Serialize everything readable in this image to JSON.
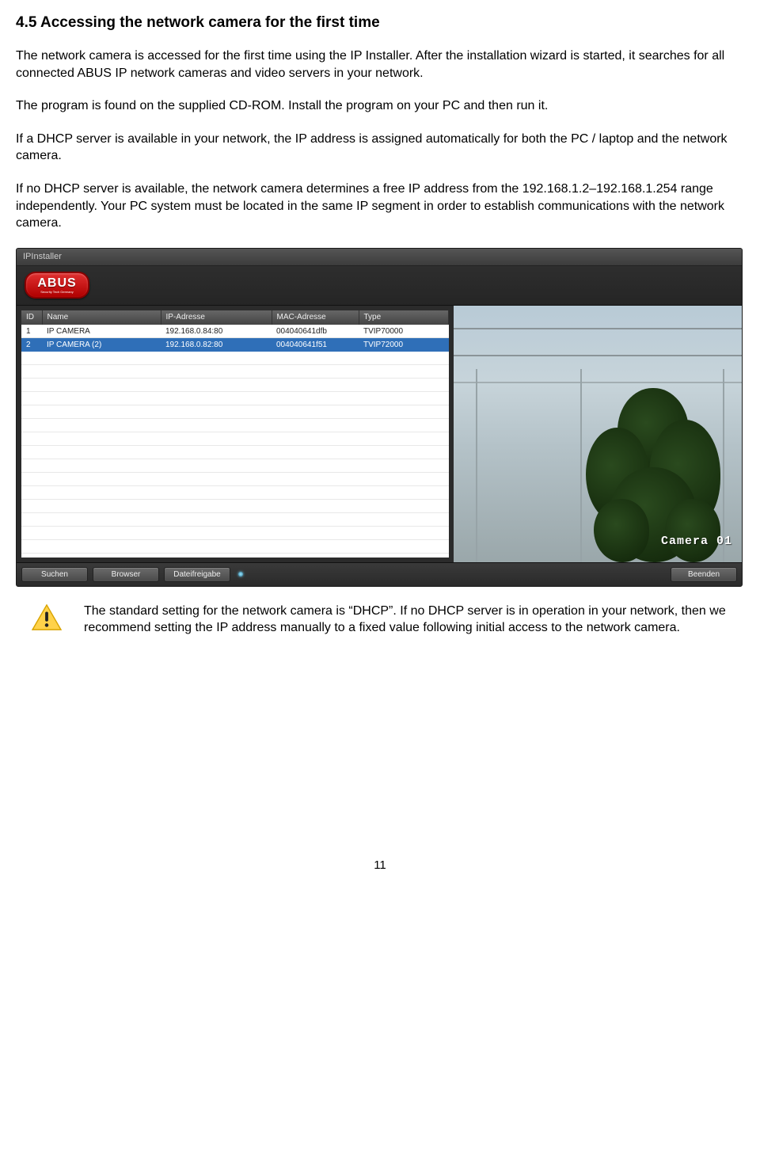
{
  "heading": "4.5 Accessing the network camera for the first time",
  "paragraphs": {
    "p1": "The network camera is accessed for the first time using the IP Installer. After the installation wizard is started, it searches for all connected ABUS IP network cameras and video servers in your network.",
    "p2": "The program is found on the supplied CD-ROM. Install the program on your PC and then run it.",
    "p3": "If a DHCP server is available in your network, the IP address is assigned automatically for both the PC / laptop and the network camera.",
    "p4": "If no DHCP server is available, the network camera determines a free IP address from the 192.168.1.2–192.168.1.254 range independently. Your PC system must be located in the same IP segment in order to establish communications with the network camera."
  },
  "ipinstaller": {
    "window_title": "IPInstaller",
    "logo_main": "ABUS",
    "logo_sub": "Security Tech Germany",
    "columns": {
      "id": "ID",
      "name": "Name",
      "ip": "IP-Adresse",
      "mac": "MAC-Adresse",
      "type": "Type"
    },
    "rows": [
      {
        "id": "1",
        "name": "IP CAMERA",
        "ip": "192.168.0.84:80",
        "mac": "004040641dfb",
        "type": "TVIP70000"
      },
      {
        "id": "2",
        "name": "IP CAMERA (2)",
        "ip": "192.168.0.82:80",
        "mac": "004040641f51",
        "type": "TVIP72000"
      }
    ],
    "preview_overlay": "Camera 01",
    "buttons": {
      "search": "Suchen",
      "browser": "Browser",
      "fileshare": "Dateifreigabe",
      "exit": "Beenden"
    }
  },
  "note": "The standard setting for the network camera is “DHCP”. If no DHCP server is in operation in your network, then we recommend setting the IP address manually to a fixed value following initial access to the network camera.",
  "page_number": "11"
}
